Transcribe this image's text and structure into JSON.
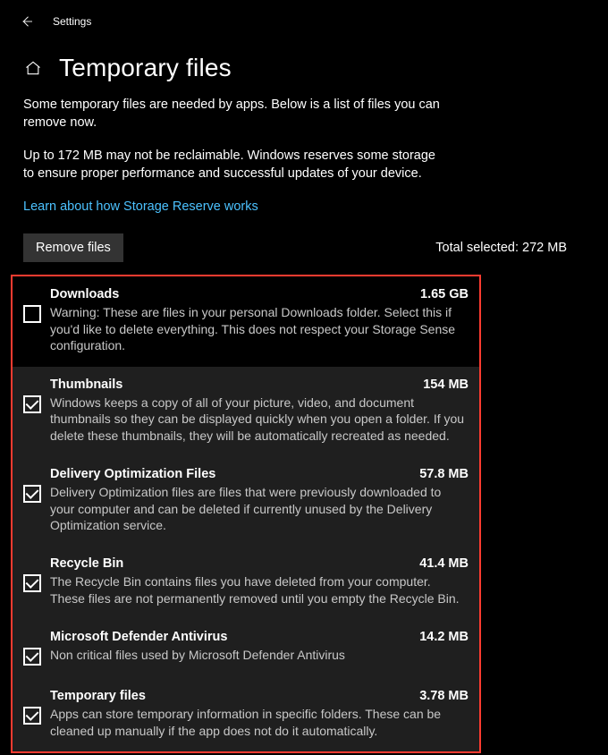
{
  "app_title": "Settings",
  "page_title": "Temporary files",
  "intro_1": "Some temporary files are needed by apps. Below is a list of files you can remove now.",
  "intro_2": "Up to 172 MB may not be reclaimable. Windows reserves some storage to ensure proper performance and successful updates of your device.",
  "link_text": "Learn about how Storage Reserve works",
  "remove_button": "Remove files",
  "total_selected": "Total selected: 272 MB",
  "items": [
    {
      "title": "Downloads",
      "size": "1.65 GB",
      "desc": "Warning: These are files in your personal Downloads folder. Select this if you'd like to delete everything. This does not respect your Storage Sense configuration."
    },
    {
      "title": "Thumbnails",
      "size": "154 MB",
      "desc": "Windows keeps a copy of all of your picture, video, and document thumbnails so they can be displayed quickly when you open a folder. If you delete these thumbnails, they will be automatically recreated as needed."
    },
    {
      "title": "Delivery Optimization Files",
      "size": "57.8 MB",
      "desc": "Delivery Optimization files are files that were previously downloaded to your computer and can be deleted if currently unused by the Delivery Optimization service."
    },
    {
      "title": "Recycle Bin",
      "size": "41.4 MB",
      "desc": "The Recycle Bin contains files you have deleted from your computer. These files are not permanently removed until you empty the Recycle Bin."
    },
    {
      "title": "Microsoft Defender Antivirus",
      "size": "14.2 MB",
      "desc": "Non critical files used by Microsoft Defender Antivirus"
    },
    {
      "title": "Temporary files",
      "size": "3.78 MB",
      "desc": "Apps can store temporary information in specific folders. These can be cleaned up manually if the app does not do it automatically."
    }
  ]
}
